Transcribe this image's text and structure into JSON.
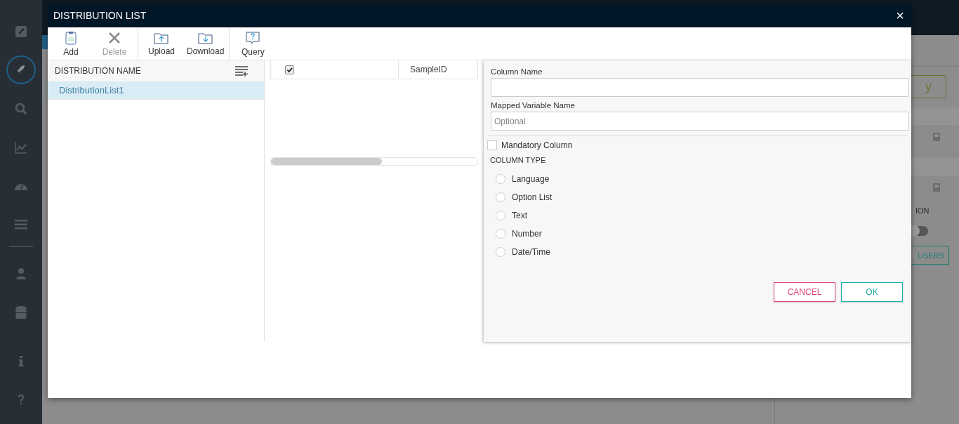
{
  "sidebar": {
    "items": [
      {
        "selected": false
      },
      {
        "selected": true
      },
      {
        "selected": false
      },
      {
        "selected": false
      },
      {
        "selected": false
      },
      {
        "selected": false
      },
      {
        "selected": false
      },
      {
        "selected": false
      },
      {
        "selected": false
      },
      {
        "selected": false
      }
    ]
  },
  "background_page": {
    "action_button": "y",
    "section_label": "ION",
    "toggle_on": false,
    "users_button": "USERS"
  },
  "dialog": {
    "title": "DISTRIBUTION LIST",
    "close": "×",
    "toolbar_groups": [
      [
        {
          "kind": "add",
          "label": "Add",
          "disabled": false
        },
        {
          "kind": "delete",
          "label": "Delete",
          "disabled": true
        }
      ],
      [
        {
          "kind": "upload",
          "label": "Upload",
          "disabled": false
        },
        {
          "kind": "download",
          "label": "Download",
          "disabled": false
        }
      ],
      [
        {
          "kind": "query",
          "label": "Query",
          "disabled": false
        }
      ]
    ],
    "list": {
      "header": "DISTRIBUTION NAME",
      "items": [
        {
          "name": "DistributionList1",
          "selected": true
        }
      ]
    },
    "grid": {
      "columns": [
        {
          "kind": "checkbox",
          "checked": true
        },
        {
          "kind": "text",
          "label": "SampleID"
        }
      ]
    },
    "form": {
      "column_name": {
        "label": "Column Name"
      },
      "mapped_variable": {
        "label": "Mapped Variable Name",
        "placeholder": "Optional"
      },
      "mandatory": {
        "label": "Mandatory Column",
        "checked": false
      },
      "column_type": {
        "label": "COLUMN TYPE",
        "options": [
          {
            "label": "Language",
            "selected": false
          },
          {
            "label": "Option List",
            "selected": false
          },
          {
            "label": "Text",
            "selected": false
          },
          {
            "label": "Number",
            "selected": false
          },
          {
            "label": "Date/Time",
            "selected": false
          }
        ]
      },
      "buttons": [
        {
          "kind": "cancel",
          "label": "CANCEL"
        },
        {
          "kind": "ok",
          "label": "OK"
        }
      ]
    }
  }
}
